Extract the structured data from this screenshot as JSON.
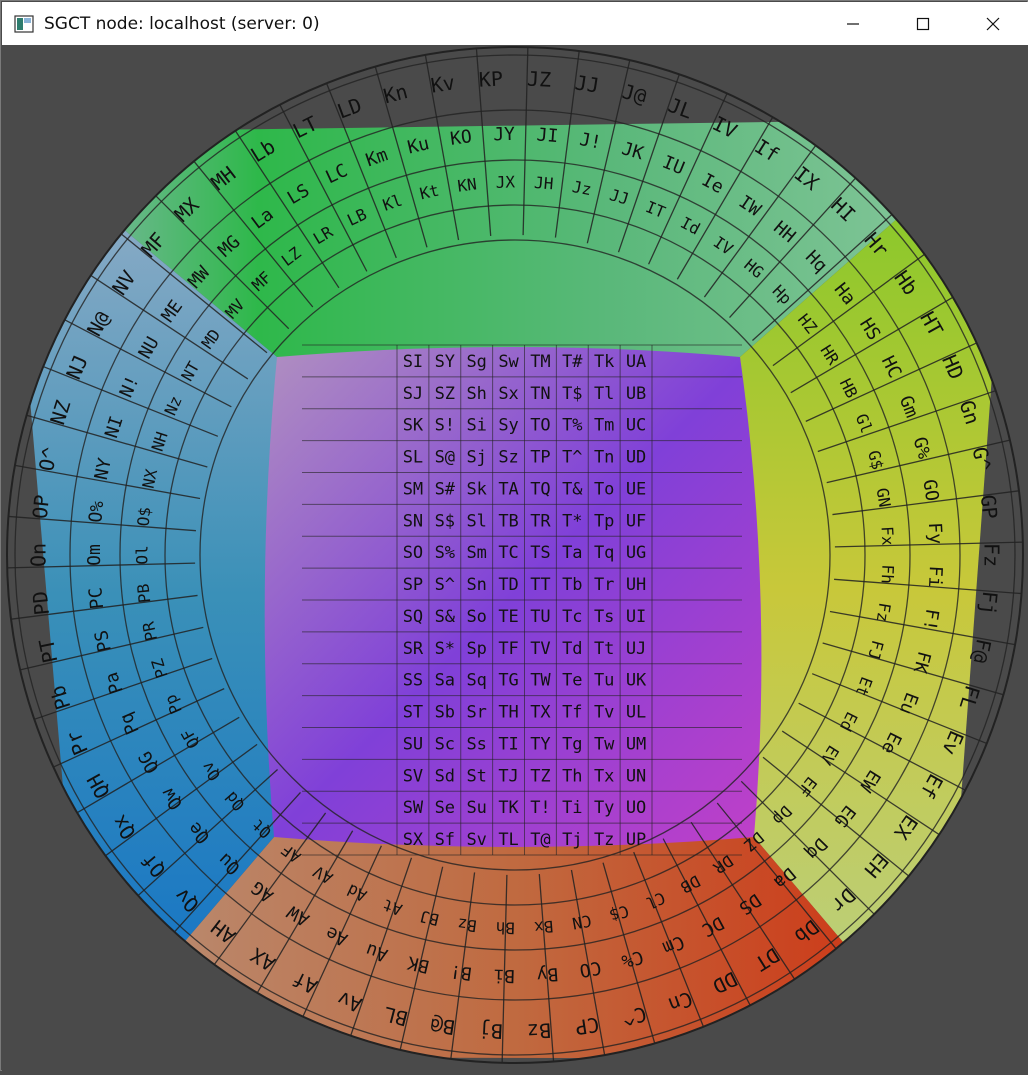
{
  "window": {
    "title": "SGCT node: localhost (server: 0)",
    "controls": [
      "minimize-icon",
      "maximize-icon",
      "close-icon"
    ]
  },
  "dome": {
    "face_colors": {
      "top": "#3fbf4f",
      "right": "#a8c83a",
      "bottom": "#c8643a",
      "left": "#3f8fc8",
      "center": "#8a3fd0"
    },
    "center_labels": [
      [
        "SI",
        "SY",
        "Sg",
        "Sw",
        "TM",
        "T#",
        "Tk",
        "UA"
      ],
      [
        "SJ",
        "SZ",
        "Sh",
        "Sx",
        "TN",
        "T$",
        "Tl",
        "UB"
      ],
      [
        "SK",
        "S!",
        "Si",
        "Sy",
        "TO",
        "T%",
        "Tm",
        "UC"
      ],
      [
        "SL",
        "S@",
        "Sj",
        "Sz",
        "TP",
        "T^",
        "Tn",
        "UD"
      ],
      [
        "SM",
        "S#",
        "Sk",
        "TA",
        "TQ",
        "T&",
        "To",
        "UE"
      ],
      [
        "SN",
        "S$",
        "Sl",
        "TB",
        "TR",
        "T*",
        "Tp",
        "UF"
      ],
      [
        "SO",
        "S%",
        "Sm",
        "TC",
        "TS",
        "Ta",
        "Tq",
        "UG"
      ],
      [
        "SP",
        "S^",
        "Sn",
        "TD",
        "TT",
        "Tb",
        "Tr",
        "UH"
      ],
      [
        "SQ",
        "S&",
        "So",
        "TE",
        "TU",
        "Tc",
        "Ts",
        "UI"
      ],
      [
        "SR",
        "S*",
        "Sp",
        "TF",
        "TV",
        "Td",
        "Tt",
        "UJ"
      ],
      [
        "SS",
        "Sa",
        "Sq",
        "TG",
        "TW",
        "Te",
        "Tu",
        "UK"
      ],
      [
        "ST",
        "Sb",
        "Sr",
        "TH",
        "TX",
        "Tf",
        "Tv",
        "UL"
      ],
      [
        "SU",
        "Sc",
        "Ss",
        "TI",
        "TY",
        "Tg",
        "Tw",
        "UM"
      ],
      [
        "SV",
        "Sd",
        "St",
        "TJ",
        "TZ",
        "Th",
        "Tx",
        "UN"
      ],
      [
        "SW",
        "Se",
        "Su",
        "TK",
        "T!",
        "Ti",
        "Ty",
        "UO"
      ],
      [
        "SX",
        "Sf",
        "Sv",
        "TL",
        "T@",
        "Tj",
        "Tz",
        "UP"
      ]
    ],
    "outer_labels": [
      "On",
      "OP",
      "O^",
      "NZ",
      "NJ",
      "N@",
      "NV",
      "MF",
      "MX",
      "MH",
      "Lb",
      "LT",
      "LD",
      "Kn",
      "Kv",
      "KP",
      "JZ",
      "JJ",
      "J@",
      "JL",
      "IV",
      "If",
      "IX",
      "HI",
      "Hr",
      "Hb",
      "HT",
      "HD",
      "Gn",
      "G^",
      "GP",
      "Fz",
      "Fj",
      "F@",
      "FL",
      "Ev",
      "Ef",
      "EX",
      "EH",
      "Dr",
      "Db",
      "DT",
      "DD",
      "Cn",
      "C^",
      "CP",
      "Bz",
      "Bj",
      "B@",
      "BL",
      "Av",
      "Af",
      "AX",
      "AH",
      "Qv",
      "Qf",
      "Qx",
      "QH",
      "Pr",
      "Pb",
      "PT",
      "PD"
    ],
    "ring2_labels": [
      "Om",
      "O%",
      "NY",
      "NI",
      "N!",
      "NU",
      "ME",
      "MW",
      "MG",
      "La",
      "LS",
      "LC",
      "Km",
      "Ku",
      "KO",
      "JY",
      "JI",
      "J!",
      "JK",
      "IU",
      "Ie",
      "IW",
      "HH",
      "Hq",
      "Ha",
      "HS",
      "HC",
      "Gm",
      "G%",
      "GO",
      "Fy",
      "Fi",
      "F!",
      "FK",
      "Eu",
      "Ee",
      "EW",
      "EG",
      "Dq",
      "Da",
      "DS",
      "DC",
      "Cm",
      "C%",
      "CO",
      "By",
      "Bi",
      "B!",
      "BK",
      "Au",
      "Ae",
      "AW",
      "AG",
      "Qu",
      "Qe",
      "Qw",
      "QG",
      "Pq",
      "Pa",
      "PS",
      "PC"
    ],
    "ring3_labels": [
      "Ol",
      "O$",
      "NX",
      "NH",
      "Nz",
      "NT",
      "MD",
      "MV",
      "MF",
      "LZ",
      "LR",
      "LB",
      "Kl",
      "Kt",
      "KN",
      "JX",
      "JH",
      "Jz",
      "JJ",
      "IT",
      "Id",
      "IV",
      "HG",
      "Hp",
      "HZ",
      "HR",
      "HB",
      "Gl",
      "G$",
      "GN",
      "Fx",
      "Fh",
      "Fz",
      "FJ",
      "Et",
      "Ed",
      "EV",
      "EF",
      "Dp",
      "DZ",
      "DR",
      "DB",
      "Cl",
      "C$",
      "CN",
      "Bx",
      "Bh",
      "Bz",
      "BJ",
      "At",
      "Ad",
      "AV",
      "AF",
      "Qt",
      "Qd",
      "Qv",
      "QF",
      "Pp",
      "PZ",
      "PR",
      "PB"
    ]
  }
}
